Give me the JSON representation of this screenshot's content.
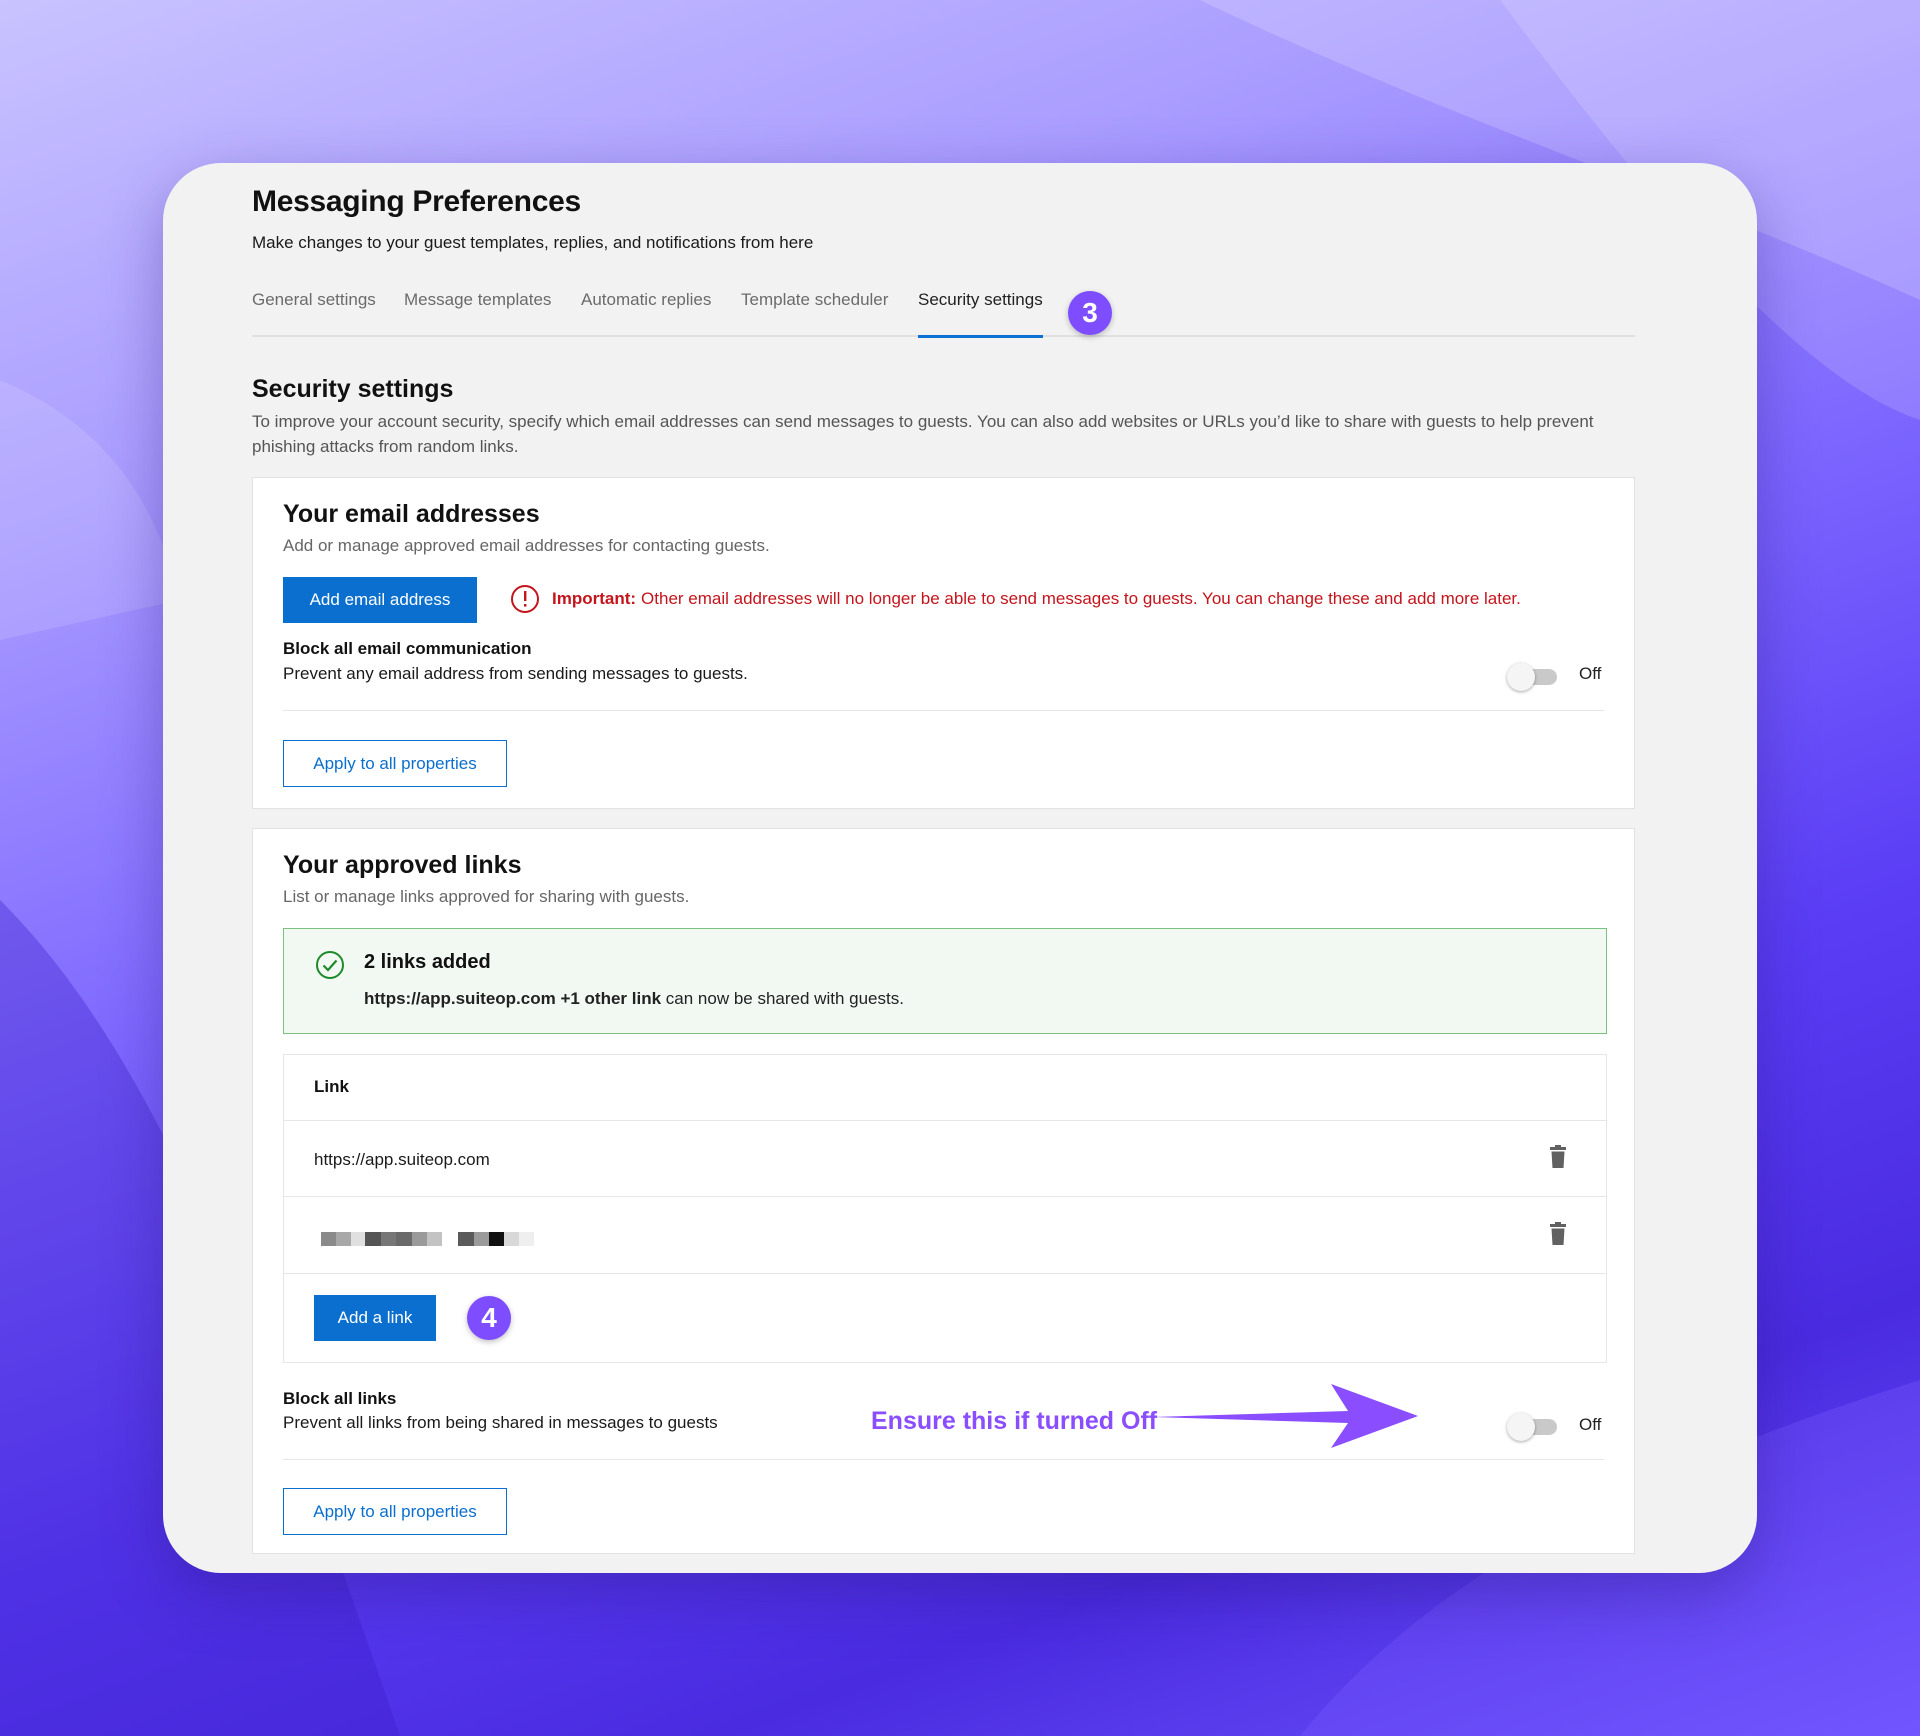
{
  "page": {
    "title": "Messaging Preferences",
    "subtitle": "Make changes to your guest templates, replies, and notifications from here"
  },
  "tabs": [
    {
      "label": "General settings",
      "active": false
    },
    {
      "label": "Message templates",
      "active": false
    },
    {
      "label": "Automatic replies",
      "active": false
    },
    {
      "label": "Template scheduler",
      "active": false
    },
    {
      "label": "Security settings",
      "active": true
    }
  ],
  "step_badges": {
    "tabs": "3",
    "add_link": "4"
  },
  "security": {
    "title": "Security settings",
    "description": "To improve your account security, specify which email addresses can send messages to guests. You can also add websites or URLs you’d like to share with guests to help prevent phishing attacks from random links."
  },
  "email_card": {
    "title": "Your email addresses",
    "description": "Add or manage approved email addresses for contacting guests.",
    "add_button": "Add email address",
    "alert_strong": "Important:",
    "alert_text": "Other email addresses will no longer be able to send messages to guests. You can change these and add more later.",
    "block_title": "Block all email communication",
    "block_desc": "Prevent any email address from sending messages to guests.",
    "toggle_label": "Off",
    "apply_button": "Apply to all properties"
  },
  "links_card": {
    "title": "Your approved links",
    "description": "List or manage links approved for sharing with guests.",
    "success_title": "2 links added",
    "success_strong": "https://app.suiteop.com +1 other link",
    "success_rest": "can now be shared with guests.",
    "table_header": "Link",
    "rows": [
      "https://app.suiteop.com"
    ],
    "add_button": "Add a link",
    "block_title": "Block all links",
    "block_desc": "Prevent all links from being shared in messages to guests",
    "toggle_label": "Off",
    "apply_button": "Apply to all properties"
  },
  "annotation": {
    "text": "Ensure this if turned Off",
    "color": "#8a4dff"
  },
  "colors": {
    "primary": "#0a6fcf",
    "badge": "#7d4dff",
    "error": "#c4141c",
    "success_border": "#7ac27e"
  },
  "icons": [
    "error-circle-icon",
    "check-circle-icon",
    "trash-icon",
    "arrow-right-icon"
  ]
}
